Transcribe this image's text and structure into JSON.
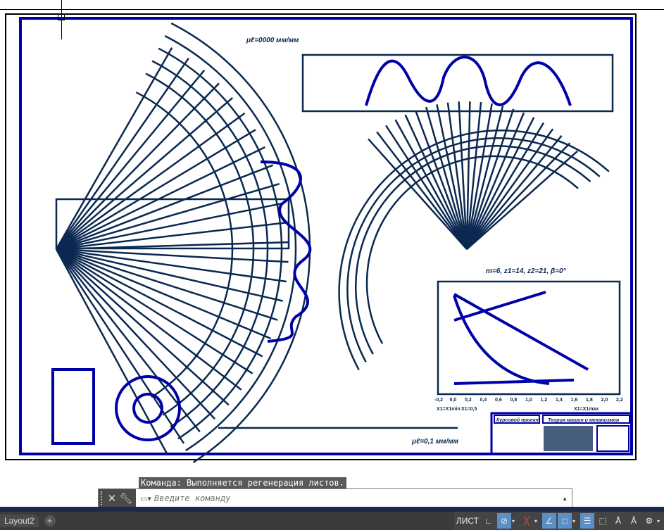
{
  "drawing": {
    "params_label": "m=6, z1=14, z2=21, β=0°",
    "scale_top": "μℓ=0000 мм/мм",
    "scale_bottom": "μℓ=0,1 мм/мм",
    "graph_x_ticks": [
      "-0,2",
      "0,0",
      "0,2",
      "0,4",
      "0,6",
      "0,8",
      "1,0",
      "1,2",
      "1,4",
      "1,6",
      "1,8",
      "2,0",
      "2,2"
    ],
    "graph_x_labels": [
      "X1=X1min",
      "X1=0,5",
      "X1=X1max"
    ],
    "title_block": {
      "left": "Курсовой проект",
      "right": "Теория машин и механизмов"
    },
    "colors": {
      "line": "#0a2850",
      "accent": "#0000a8"
    }
  },
  "command": {
    "history": "Команда: Выполняется регенерация листов.",
    "placeholder": "Введите команду"
  },
  "layout_tabs": [
    {
      "label": "Layout2"
    }
  ],
  "status": {
    "space": "ЛИСТ"
  }
}
